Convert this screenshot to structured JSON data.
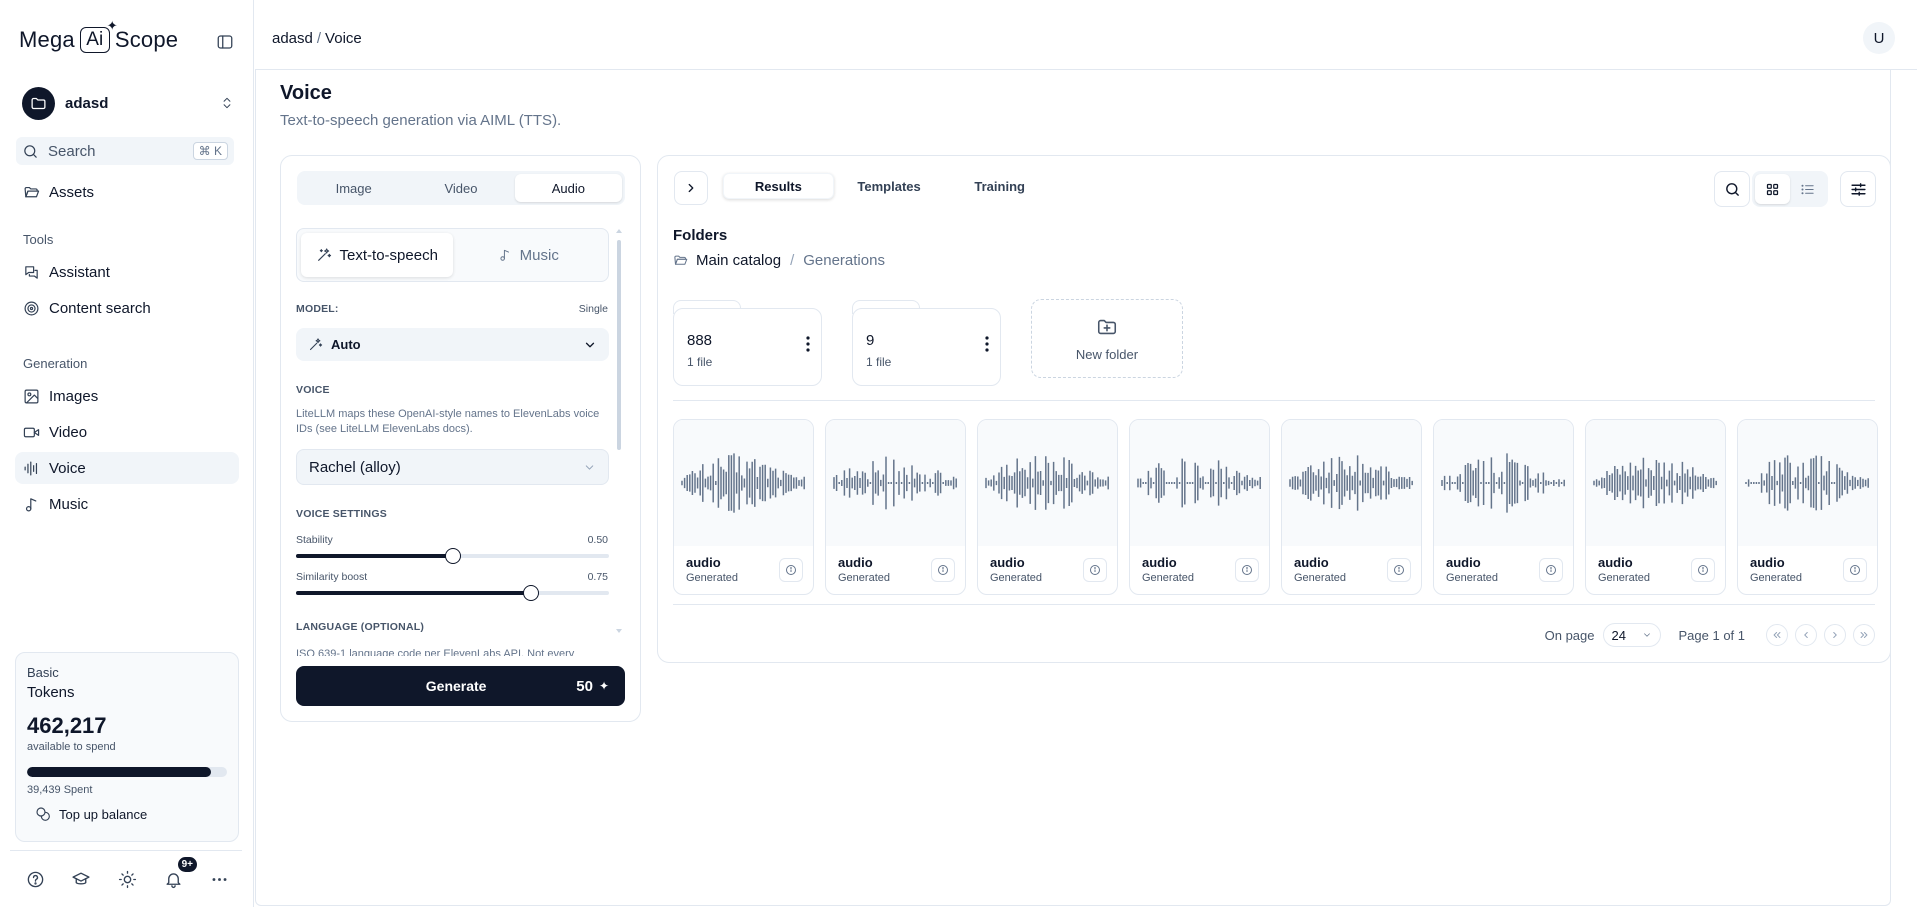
{
  "brand": {
    "left": "Mega",
    "middle": "Ai",
    "right": "Scope"
  },
  "workspace": {
    "name": "adasd"
  },
  "search": {
    "label": "Search",
    "shortcut": "⌘ K"
  },
  "nav": {
    "assets": "Assets",
    "tools_label": "Tools",
    "assistant": "Assistant",
    "content_search": "Content search",
    "generation_label": "Generation",
    "images": "Images",
    "video": "Video",
    "voice": "Voice",
    "music": "Music"
  },
  "tokens": {
    "plan": "Basic",
    "title": "Tokens",
    "amount": "462,217",
    "available": "available to spend",
    "fraction_available": 0.92,
    "spent": "39,439 Spent",
    "topup": "Top up balance"
  },
  "notifications": {
    "badge": "9+"
  },
  "header": {
    "crumb_workspace": "adasd",
    "crumb_page": "Voice",
    "avatar": "U"
  },
  "page": {
    "title": "Voice",
    "subtitle": "Text-to-speech generation via AIML (TTS)."
  },
  "generator": {
    "mode_tabs": [
      "Image",
      "Video",
      "Audio"
    ],
    "active_mode": "Audio",
    "sub_tabs": {
      "tts": "Text-to-speech",
      "music": "Music"
    },
    "model_label": "MODEL:",
    "model_mode": "Single",
    "model_value": "Auto",
    "voice_label": "VOICE",
    "voice_help": "LiteLLM maps these OpenAI-style names to ElevenLabs voice IDs (see LiteLLM ElevenLabs docs).",
    "voice_value": "Rachel (alloy)",
    "voice_settings_label": "VOICE SETTINGS",
    "stability": {
      "label": "Stability",
      "display": "0.50",
      "value": 0.5
    },
    "similarity": {
      "label": "Similarity boost",
      "display": "0.75",
      "value": 0.75
    },
    "language_label": "LANGUAGE (OPTIONAL)",
    "language_help": "ISO 639-1 language code per ElevenLabs API. Not every",
    "generate_label": "Generate",
    "generate_cost": "50"
  },
  "results": {
    "tabs": [
      "Results",
      "Templates",
      "Training"
    ],
    "active_tab": "Results",
    "folders_title": "Folders",
    "breadcrumb_root": "Main catalog",
    "breadcrumb_current": "Generations",
    "folders": [
      {
        "name": "888",
        "count": "1 file"
      },
      {
        "name": "9",
        "count": "1 file"
      }
    ],
    "new_folder": "New folder",
    "cards": [
      {
        "title": "audio",
        "status": "Generated"
      },
      {
        "title": "audio",
        "status": "Generated"
      },
      {
        "title": "audio",
        "status": "Generated"
      },
      {
        "title": "audio",
        "status": "Generated"
      },
      {
        "title": "audio",
        "status": "Generated"
      },
      {
        "title": "audio",
        "status": "Generated"
      },
      {
        "title": "audio",
        "status": "Generated"
      },
      {
        "title": "audio",
        "status": "Generated"
      }
    ],
    "pagination": {
      "on_page_label": "On page",
      "per_page": "24",
      "page_info": "Page 1 of 1"
    }
  },
  "colors": {
    "primary": "#0f172a",
    "muted": "#64748b",
    "border": "#e2e8f0",
    "surface": "#f1f5f9",
    "wave": "#64748b"
  }
}
